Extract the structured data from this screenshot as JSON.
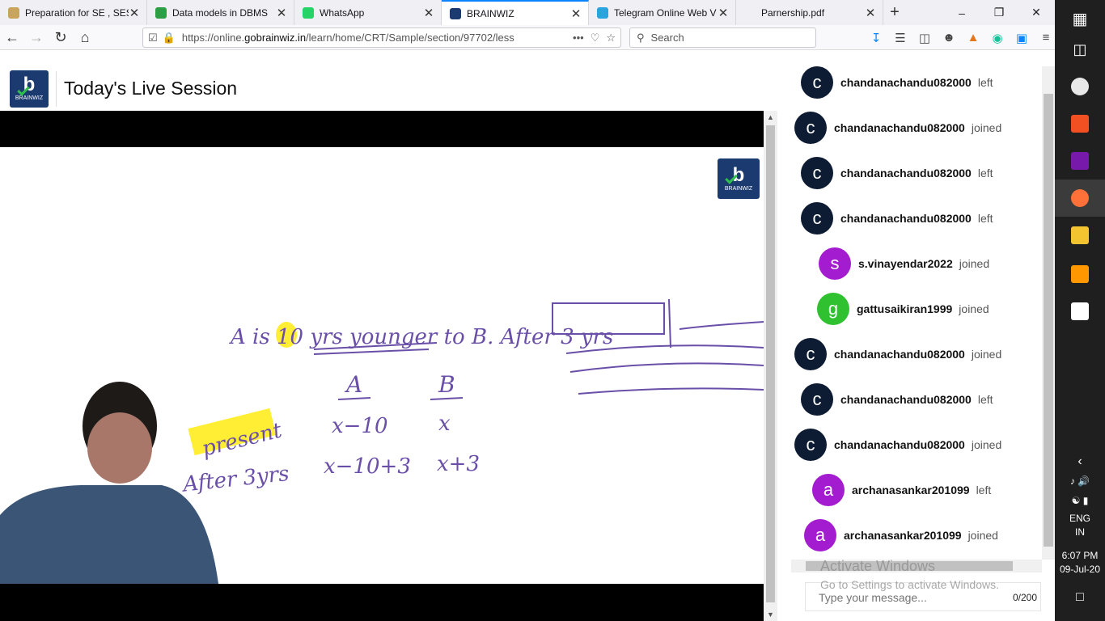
{
  "browser": {
    "tabs": [
      {
        "label": "Preparation for SE , SES",
        "icon": "book-icon",
        "color": "#c9a45b",
        "active": false
      },
      {
        "label": "Data models in DBMS",
        "icon": "b-badge-icon",
        "color": "#2e9e44",
        "active": false
      },
      {
        "label": "WhatsApp",
        "icon": "whatsapp-icon",
        "color": "#25d366",
        "active": false
      },
      {
        "label": "BRAINWIZ",
        "icon": "brainwiz-icon",
        "color": "#1b3a6f",
        "active": true
      },
      {
        "label": "Telegram Online Web V",
        "icon": "telegram-icon",
        "color": "#2aa3df",
        "active": false
      },
      {
        "label": "Parnership.pdf",
        "icon": "pdf-icon",
        "color": "#f0f0f4",
        "active": false
      }
    ],
    "url_prefix": "https://online.",
    "url_domain": "gobrainwiz.in",
    "url_path": "/learn/home/CRT/Sample/section/97702/less",
    "search_placeholder": "Search"
  },
  "page": {
    "title": "Today's Live Session",
    "logo_text": "BRAINWIZ",
    "logo_letter": "b"
  },
  "whiteboard": {
    "line1": "A is 10 yrs younger to B. After 3 yrs",
    "col_a": "A",
    "col_b": "B",
    "row1_label": "present",
    "row1_a": "x−10",
    "row1_b": "x",
    "row2_label": "After 3yrs",
    "row2_a": "x−10+3",
    "row2_b": "x+3"
  },
  "chat": {
    "messages": [
      {
        "initial": "c",
        "user": "chandanachandu082000",
        "status": "left",
        "color": "#0d1b33"
      },
      {
        "initial": "c",
        "user": "chandanachandu082000",
        "status": "joined",
        "color": "#0d1b33"
      },
      {
        "initial": "c",
        "user": "chandanachandu082000",
        "status": "left",
        "color": "#0d1b33"
      },
      {
        "initial": "c",
        "user": "chandanachandu082000",
        "status": "left",
        "color": "#0d1b33"
      },
      {
        "initial": "s",
        "user": "s.vinayendar2022",
        "status": "joined",
        "color": "#a31ccf"
      },
      {
        "initial": "g",
        "user": "gattusaikiran1999",
        "status": "joined",
        "color": "#2fc12f"
      },
      {
        "initial": "c",
        "user": "chandanachandu082000",
        "status": "joined",
        "color": "#0d1b33"
      },
      {
        "initial": "c",
        "user": "chandanachandu082000",
        "status": "left",
        "color": "#0d1b33"
      },
      {
        "initial": "c",
        "user": "chandanachandu082000",
        "status": "joined",
        "color": "#0d1b33"
      },
      {
        "initial": "a",
        "user": "archanasankar201099",
        "status": "left",
        "color": "#a31ccf"
      },
      {
        "initial": "a",
        "user": "archanasankar201099",
        "status": "joined",
        "color": "#a31ccf"
      }
    ],
    "input_placeholder": "Type your message...",
    "char_count": "0/200",
    "watermark_title": "Activate Windows",
    "watermark_sub": "Go to Settings to activate Windows."
  },
  "taskbar": {
    "language": "ENG",
    "region": "IN",
    "time": "6:07 PM",
    "date": "09-Jul-20"
  }
}
